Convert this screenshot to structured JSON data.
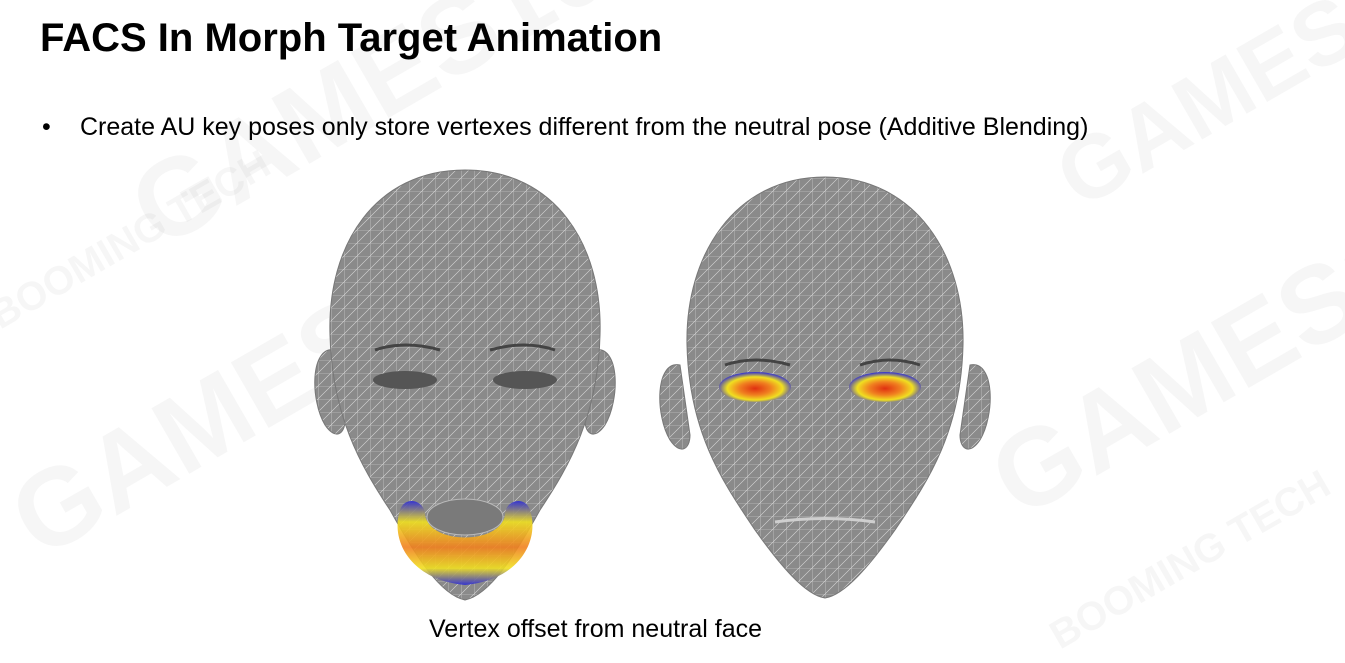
{
  "slide": {
    "title": "FACS In Morph Target Animation",
    "bullets": [
      {
        "marker": "•",
        "text": "Create AU key poses only store vertexes different from the neutral pose (Additive Blending)"
      }
    ],
    "caption": "Vertex offset from neutral face"
  },
  "figure": {
    "faces": [
      {
        "highlight_region": "mouth-jaw"
      },
      {
        "highlight_region": "eyelids"
      }
    ],
    "heatmap_colors": [
      "#2b2bd6",
      "#f0e020",
      "#f08020",
      "#e03010"
    ],
    "mesh_color": "#8a8a8a"
  },
  "watermark": {
    "brand": "GAMES104",
    "sub": "BOOMING TECH"
  }
}
